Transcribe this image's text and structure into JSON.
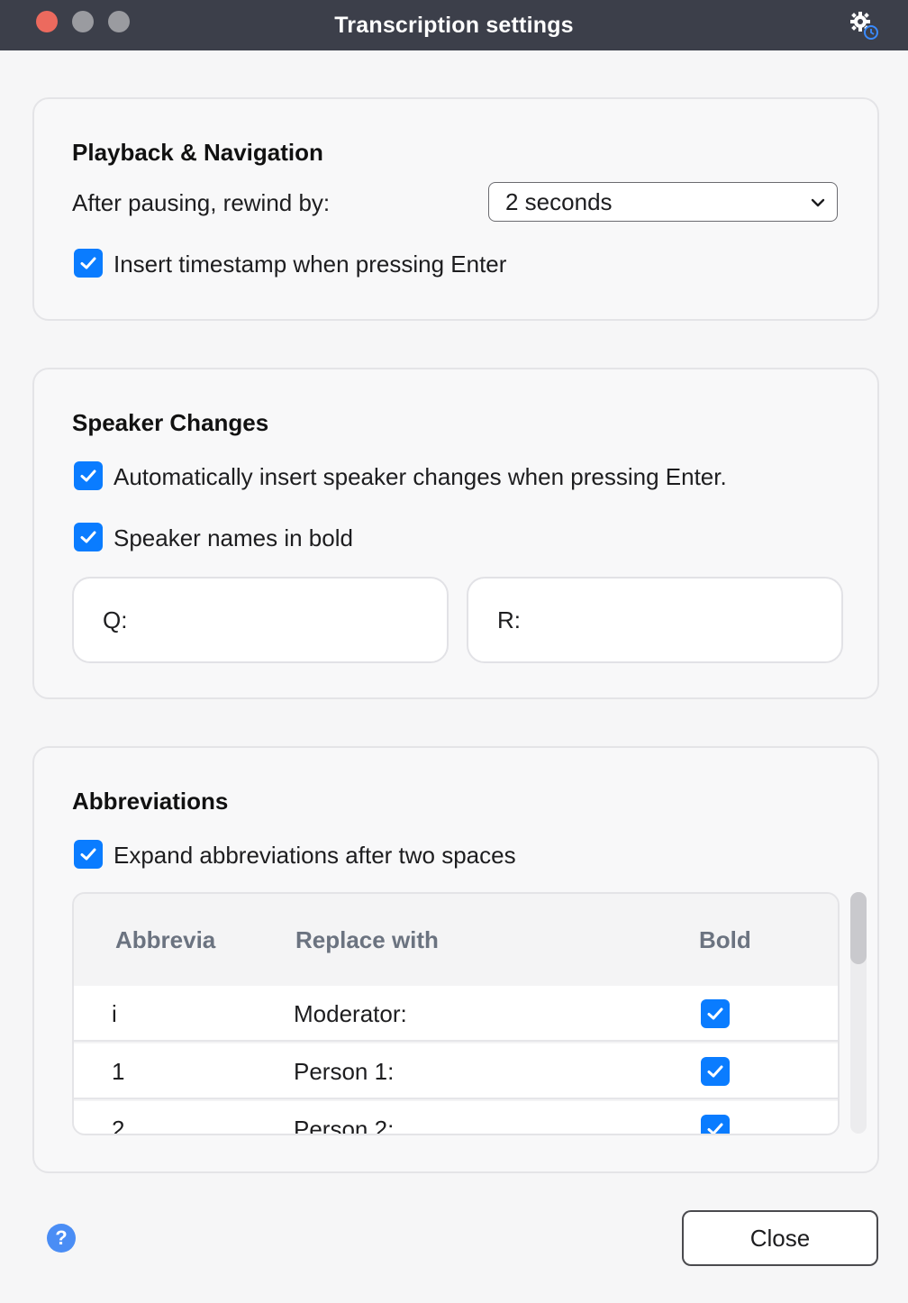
{
  "window": {
    "title": "Transcription settings"
  },
  "playback": {
    "heading": "Playback & Navigation",
    "rewind_label": "After pausing, rewind by:",
    "rewind_value": "2 seconds",
    "timestamp_label": "Insert timestamp when pressing Enter",
    "timestamp_checked": true
  },
  "speaker": {
    "heading": "Speaker Changes",
    "auto_insert_label": "Automatically insert speaker changes when pressing Enter.",
    "auto_insert_checked": true,
    "bold_label": "Speaker names in bold",
    "bold_checked": true,
    "speaker_a": "Q:",
    "speaker_b": "R:"
  },
  "abbreviations": {
    "heading": "Abbreviations",
    "expand_label": "Expand abbreviations after two spaces",
    "expand_checked": true,
    "columns": [
      "Abbrevia",
      "Replace with",
      "Bold"
    ],
    "rows": [
      {
        "abbr": "i",
        "replace": "Moderator:",
        "bold": true
      },
      {
        "abbr": "1",
        "replace": "Person 1:",
        "bold": true
      },
      {
        "abbr": "2",
        "replace": "Person 2:",
        "bold": true
      }
    ]
  },
  "footer": {
    "help": "?",
    "close_label": "Close"
  },
  "colors": {
    "accent": "#0a7cff",
    "titlebar": "#3c3f4a",
    "close_light": "#ec6a5e"
  }
}
